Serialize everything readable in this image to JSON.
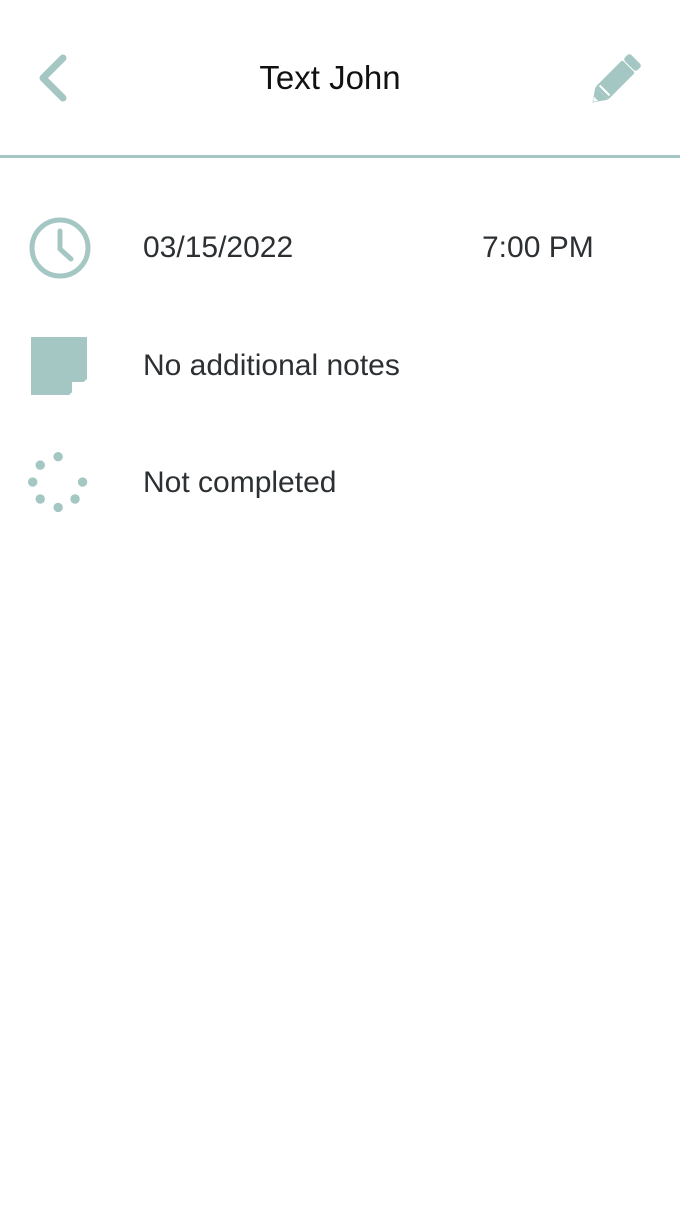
{
  "header": {
    "title": "Text John",
    "back_icon": "chevron-left-icon",
    "edit_icon": "pencil-icon"
  },
  "details": {
    "date": "03/15/2022",
    "time": "7:00 PM",
    "notes": "No additional notes",
    "status": "Not completed",
    "icons": {
      "schedule": "clock-icon",
      "notes": "sticky-note-icon",
      "status": "loading-dots-icon"
    }
  },
  "theme": {
    "accent": "#a5c7c4",
    "text": "#2c3033",
    "title": "#111111",
    "background": "#ffffff"
  }
}
